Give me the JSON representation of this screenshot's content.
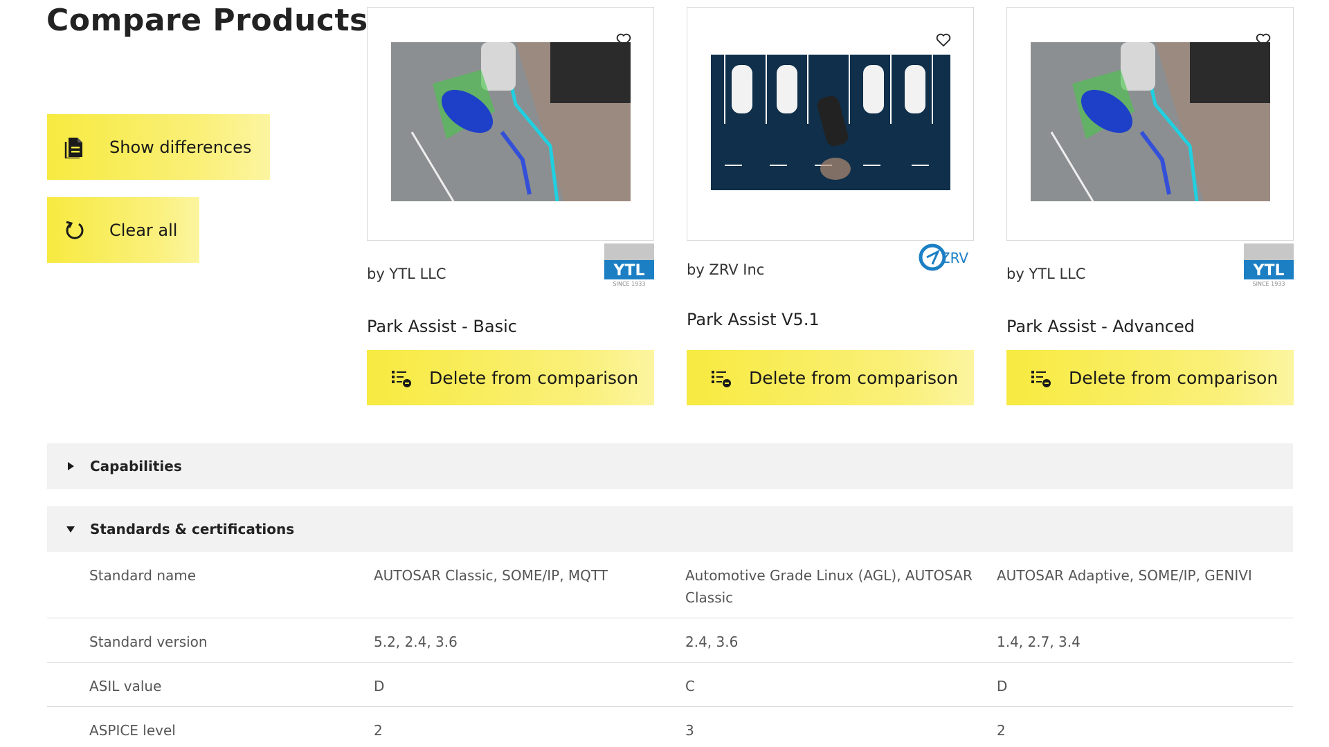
{
  "page": {
    "title": "Compare Products"
  },
  "actions": {
    "show_differences": "Show differences",
    "clear_all": "Clear all"
  },
  "products": [
    {
      "vendor": "by YTL LLC",
      "name": "Park Assist - Basic",
      "delete_label": "Delete from comparison",
      "logo": "YTL",
      "logo_sub": "SINCE 1933"
    },
    {
      "vendor": "by ZRV Inc",
      "name": "Park Assist V5.1",
      "delete_label": "Delete from comparison",
      "logo": "ZRV"
    },
    {
      "vendor": "by YTL LLC",
      "name": "Park Assist - Advanced",
      "delete_label": "Delete from comparison",
      "logo": "YTL",
      "logo_sub": "SINCE 1933"
    }
  ],
  "sections": {
    "capabilities": {
      "title": "Capabilities",
      "expanded": false
    },
    "standards": {
      "title": "Standards & certifications",
      "expanded": true
    }
  },
  "standards_rows": [
    {
      "label": "Standard name",
      "values": [
        "AUTOSAR Classic, SOME/IP, MQTT",
        "Automotive Grade Linux (AGL), AUTOSAR Classic",
        "AUTOSAR Adaptive, SOME/IP, GENIVI"
      ]
    },
    {
      "label": "Standard version",
      "values": [
        "5.2, 2.4, 3.6",
        "2.4, 3.6",
        "1.4, 2.7, 3.4"
      ]
    },
    {
      "label": "ASIL value",
      "values": [
        "D",
        "C",
        "D"
      ]
    },
    {
      "label": "ASPICE level",
      "values": [
        "2",
        "3",
        "2"
      ]
    }
  ],
  "colors": {
    "accent": "#f7ea40",
    "section_bg": "#f2f2f2",
    "logo_blue": "#1c7fc4"
  }
}
